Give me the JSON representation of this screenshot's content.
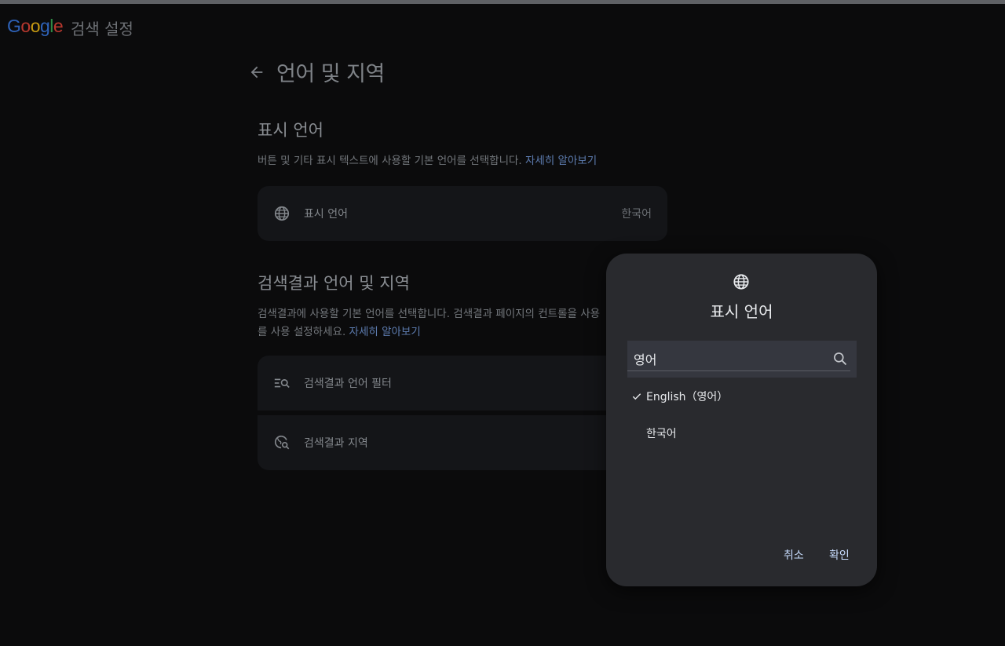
{
  "header": {
    "logo_letters": [
      "G",
      "o",
      "o",
      "g",
      "l",
      "e"
    ],
    "suffix": "검색 설정"
  },
  "page": {
    "title": "언어 및 지역"
  },
  "display_language_section": {
    "title": "표시 언어",
    "description": "버튼 및 기타 표시 텍스트에 사용할 기본 언어를 선택합니다.",
    "learn_more": "자세히 알아보기",
    "card": {
      "label": "표시 언어",
      "value": "한국어",
      "icon": "globe-icon"
    }
  },
  "search_results_section": {
    "title": "검색결과 언어 및 지역",
    "description_line1": "검색결과에 사용할 기본 언어를 선택합니다. 검색결과 페이지의 컨트롤을 사용",
    "description_line2": "를 사용 설정하세요.",
    "learn_more": "자세히 알아보기",
    "items": [
      {
        "label": "검색결과 언어 필터",
        "icon": "language-filter-icon"
      },
      {
        "label": "검색결과 지역",
        "icon": "region-search-icon"
      }
    ]
  },
  "dialog": {
    "title": "표시 언어",
    "icon": "globe-icon",
    "search_value": "영어",
    "options": [
      {
        "label": "English（영어）",
        "selected": true
      },
      {
        "label": "한국어",
        "selected": false
      }
    ],
    "cancel_label": "취소",
    "confirm_label": "확인"
  },
  "colors": {
    "background": "#0b0b0c",
    "dialog_bg": "#292a2e",
    "link": "#5d7cb0",
    "button_text": "#c8ddff"
  }
}
